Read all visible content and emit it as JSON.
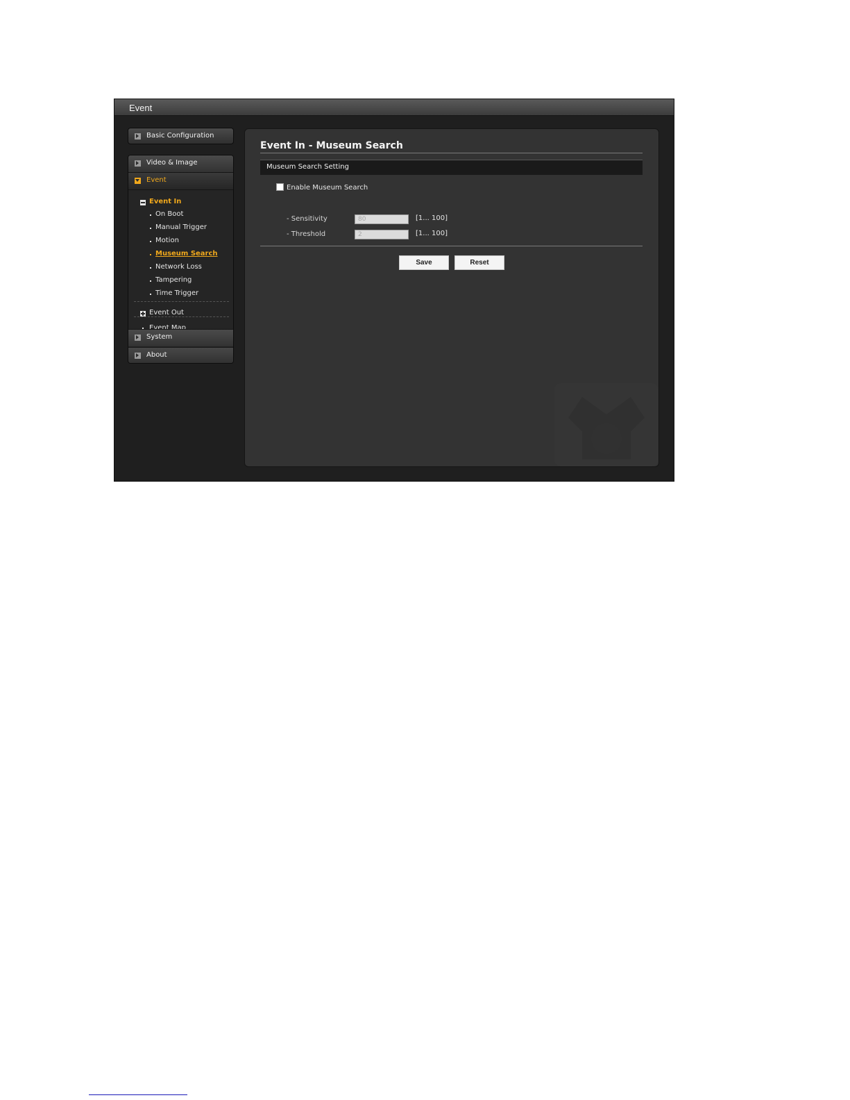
{
  "window": {
    "title": "Event"
  },
  "sidebar": {
    "basic_configuration": "Basic Configuration",
    "video_image": "Video & Image",
    "event": "Event",
    "event_in": "Event In",
    "event_in_items": {
      "on_boot": "On Boot",
      "manual_trigger": "Manual Trigger",
      "motion": "Motion",
      "museum_search": "Museum Search",
      "network_loss": "Network Loss",
      "tampering": "Tampering",
      "time_trigger": "Time Trigger"
    },
    "event_out": "Event Out",
    "event_map": "Event Map",
    "system": "System",
    "about": "About"
  },
  "main": {
    "title": "Event In - Museum Search",
    "section": "Museum Search Setting",
    "enable_label": "Enable Museum Search",
    "enable_checked": false,
    "sensitivity": {
      "label": "- Sensitivity",
      "value": "80",
      "range": "[1... 100]"
    },
    "threshold": {
      "label": "- Threshold",
      "value": "2",
      "range": "[1... 100]"
    },
    "save_label": "Save",
    "reset_label": "Reset"
  },
  "colors": {
    "accent": "#f0a81c",
    "panel_bg": "#333333",
    "app_bg": "#1f1f1f"
  }
}
